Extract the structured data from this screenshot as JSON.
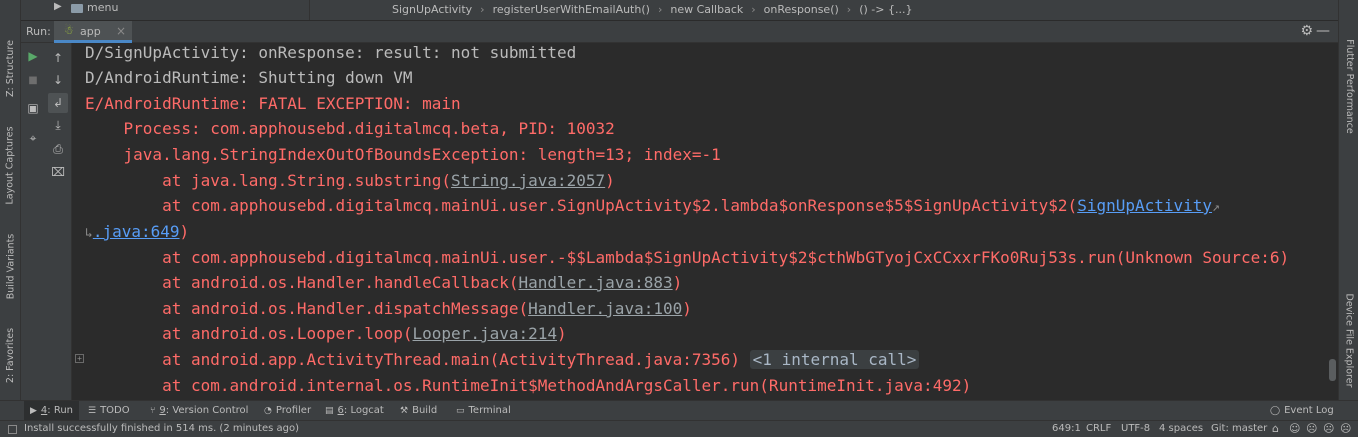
{
  "project_tree": {
    "label": "menu"
  },
  "breadcrumbs": [
    "SignUpActivity",
    "registerUserWithEmailAuth()",
    "new Callback",
    "onResponse()",
    "() -> {...}"
  ],
  "breadcrumb_separator": "›",
  "run_window": {
    "run_label": "Run:",
    "tab_label": "app",
    "tab_close": "×",
    "settings_glyph": "⚙",
    "minimize_glyph": "—"
  },
  "toolbar_glyphs": {
    "rerun": "▶",
    "stop": "■",
    "layout": "▣",
    "pin": "⌖",
    "up": "↑",
    "down": "↓",
    "soft_wrap": "↲",
    "scroll_end": "⤓",
    "print": "⎙",
    "trash": "⌧"
  },
  "left_tool_tabs": [
    "Z: Structure",
    "Layout Captures",
    "Build Variants",
    "2: Favorites"
  ],
  "right_tool_tabs": [
    "Flutter Performance",
    "Device File Explorer"
  ],
  "console": {
    "line1": "D/SignUpActivity: onResponse: result: not submitted",
    "line2": "D/AndroidRuntime: Shutting down VM",
    "line3": "E/AndroidRuntime: FATAL EXCEPTION: main",
    "line4": "    Process: com.apphousebd.digitalmcq.beta, PID: 10032",
    "line5": "    java.lang.StringIndexOutOfBoundsException: length=13; index=-1",
    "line6_pre": "        at java.lang.String.substring(",
    "line6_link": "String.java:2057",
    "line6_post": ")",
    "line7_pre": "        at com.apphousebd.digitalmcq.mainUi.user.SignUpActivity$2.lambda$onResponse$5$SignUpActivity$2(",
    "line7_link": "SignUpActivity",
    "wrap_right": "↗",
    "wrap_left": "↳",
    "line8_link": ".java:649",
    "line8_post": ")",
    "line9": "        at com.apphousebd.digitalmcq.mainUi.user.-$$Lambda$SignUpActivity$2$cthWbGTyojCxCCxxrFKo0Ruj53s.run(Unknown Source:6)",
    "line10_pre": "        at android.os.Handler.handleCallback(",
    "line10_link": "Handler.java:883",
    "line10_post": ")",
    "line11_pre": "        at android.os.Handler.dispatchMessage(",
    "line11_link": "Handler.java:100",
    "line11_post": ")",
    "line12_pre": "        at android.os.Looper.loop(",
    "line12_link": "Looper.java:214",
    "line12_post": ")",
    "line13_pre": "        at android.app.ActivityThread.main(ActivityThread.java:7356)",
    "line13_fold": "<1 internal call>",
    "line14": "        at com.android.internal.os.RuntimeInit$MethodAndArgsCaller.run(RuntimeInit.java:492)",
    "fold_marker": "+"
  },
  "bottom_tabs": {
    "run": {
      "num": "4",
      "label": ": Run"
    },
    "todo": {
      "label": "TODO"
    },
    "vcs": {
      "num": "9",
      "label": ": Version Control"
    },
    "profiler": {
      "label": "Profiler"
    },
    "logcat": {
      "num": "6",
      "label": ": Logcat"
    },
    "build": {
      "label": "Build"
    },
    "terminal": {
      "label": "Terminal"
    },
    "event_log": {
      "label": "Event Log"
    }
  },
  "status": {
    "message": "Install successfully finished in 514 ms. (2 minutes ago)",
    "position": "649:1",
    "line_sep": "CRLF",
    "encoding": "UTF-8",
    "indent": "4 spaces",
    "vcs_branch": "Git: master"
  },
  "colors": {
    "background": "#2b2b2b",
    "panel": "#3c3f41",
    "error_text": "#ff6b68",
    "link_blue": "#589df6",
    "accent_tab": "#4a88c7",
    "run_green": "#59a869"
  }
}
